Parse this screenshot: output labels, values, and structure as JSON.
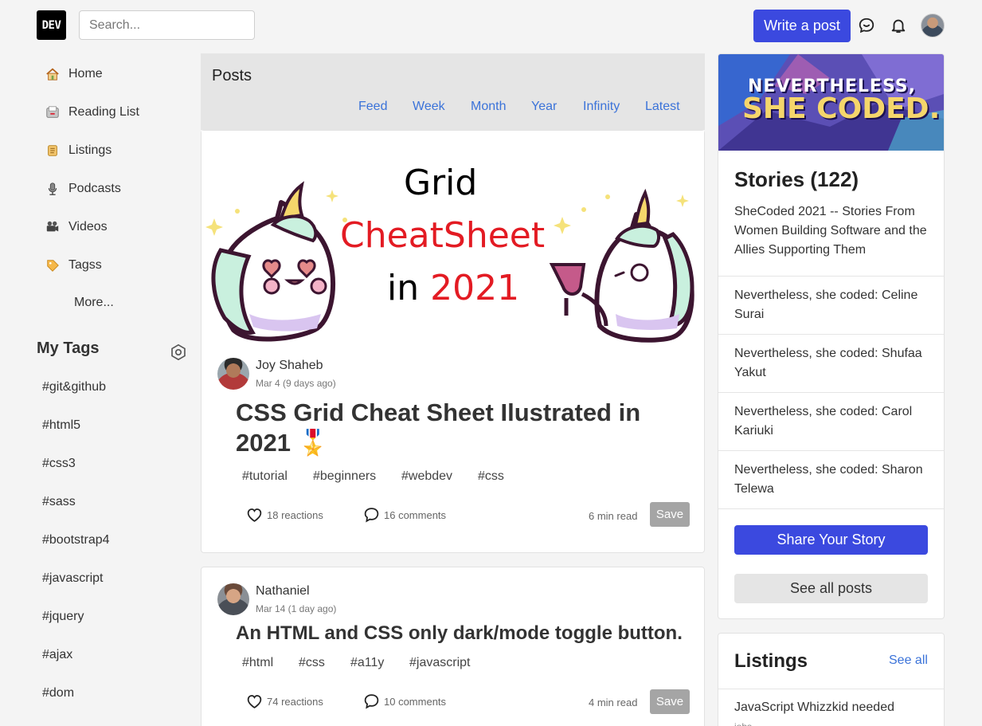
{
  "header": {
    "logo": "DEV",
    "search_placeholder": "Search...",
    "write_post": "Write a post"
  },
  "sidebar": {
    "items": [
      {
        "label": "Home",
        "icon": "house-icon"
      },
      {
        "label": "Reading List",
        "icon": "file-box-icon"
      },
      {
        "label": "Listings",
        "icon": "scroll-icon"
      },
      {
        "label": "Podcasts",
        "icon": "microphone-icon"
      },
      {
        "label": "Videos",
        "icon": "movie-camera-icon"
      },
      {
        "label": "Tagss",
        "icon": "label-tag-icon"
      }
    ],
    "more": "More...",
    "my_tags_title": "My Tags",
    "tags": [
      "#git&github",
      "#html5",
      "#css3",
      "#sass",
      "#bootstrap4",
      "#javascript",
      "#jquery",
      "#ajax",
      "#dom"
    ]
  },
  "posts": {
    "title": "Posts",
    "filters": [
      "Feed",
      "Week",
      "Month",
      "Year",
      "Infinity",
      "Latest"
    ],
    "list": [
      {
        "cover": {
          "line1": "Grid",
          "line2": "CheatSheet",
          "line3_a": "in ",
          "line3_b": "2021"
        },
        "author": "Joy Shaheb",
        "date": "Mar 4 (9 days ago)",
        "title_line1": "CSS Grid Cheat Sheet Ilustrated in",
        "title_line2": "2021 🎖️",
        "tags": [
          "#tutorial",
          "#beginners",
          "#webdev",
          "#css"
        ],
        "reactions": "18 reactions",
        "comments": "16 comments",
        "read_time": "6 min read",
        "save": "Save"
      },
      {
        "author": "Nathaniel",
        "date": "Mar 14 (1 day ago)",
        "title": "An HTML and CSS only dark/mode toggle button.",
        "tags": [
          "#html",
          "#css",
          "#a11y",
          "#javascript"
        ],
        "reactions": "74 reactions",
        "comments": "10 comments",
        "read_time": "4 min read",
        "save": "Save"
      }
    ]
  },
  "right": {
    "banner": {
      "line1": "NEVERTHELESS,",
      "line2": "SHE CODED."
    },
    "stories_title": "Stories (122)",
    "stories_desc": "SheCoded 2021 -- Stories From Women Building Software and the Allies Supporting Them",
    "stories": [
      "Nevertheless, she coded: Celine Surai",
      "Nevertheless, she coded: Shufaa Yakut",
      "Nevertheless, she coded: Carol Kariuki",
      "Nevertheless, she coded: Sharon Telewa"
    ],
    "share_btn": "Share Your Story",
    "see_all_btn": "See all posts",
    "listings_title": "Listings",
    "listings_see_all": "See all",
    "listing_item": "JavaScript Whizzkid needed",
    "listing_sub": "jobs"
  },
  "colors": {
    "accent": "#3b49df",
    "link": "#3b73d9",
    "save_button": "#a5a5a5",
    "cover_red": "#e31b23"
  }
}
